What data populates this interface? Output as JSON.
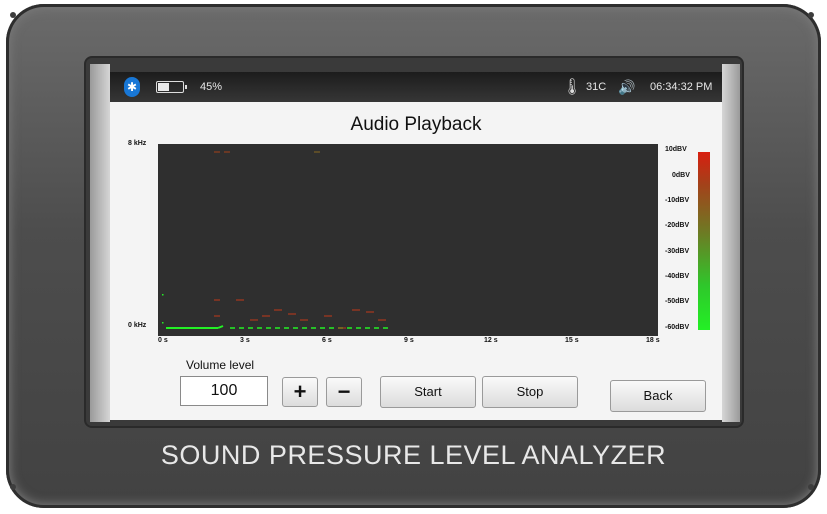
{
  "status": {
    "battery_percent": "45%",
    "battery_level": 0.45,
    "temperature": "31C",
    "time": "06:34:32 PM",
    "icons": [
      "bluetooth-icon",
      "battery-icon",
      "thermometer-icon",
      "speaker-icon"
    ]
  },
  "page": {
    "title": "Audio Playback"
  },
  "spectrogram": {
    "y_top_label": "8 kHz",
    "y_bottom_label": "0 kHz",
    "x_ticks": [
      "0 s",
      "3 s",
      "6 s",
      "9 s",
      "12 s",
      "15 s",
      "18 s"
    ],
    "scale_labels": [
      "10dBV",
      "0dBV",
      "-10dBV",
      "-20dBV",
      "-30dBV",
      "-40dBV",
      "-50dBV",
      "-60dBV"
    ],
    "colors": {
      "background": "#2f2f2f",
      "low": "#23f025",
      "high": "#d81f10"
    }
  },
  "controls": {
    "volume_label": "Volume level",
    "volume_value": "100",
    "plus_label": "+",
    "minus_label": "−",
    "start_label": "Start",
    "stop_label": "Stop",
    "back_label": "Back"
  },
  "device": {
    "brand": "SOUND PRESSURE LEVEL ANALYZER"
  }
}
